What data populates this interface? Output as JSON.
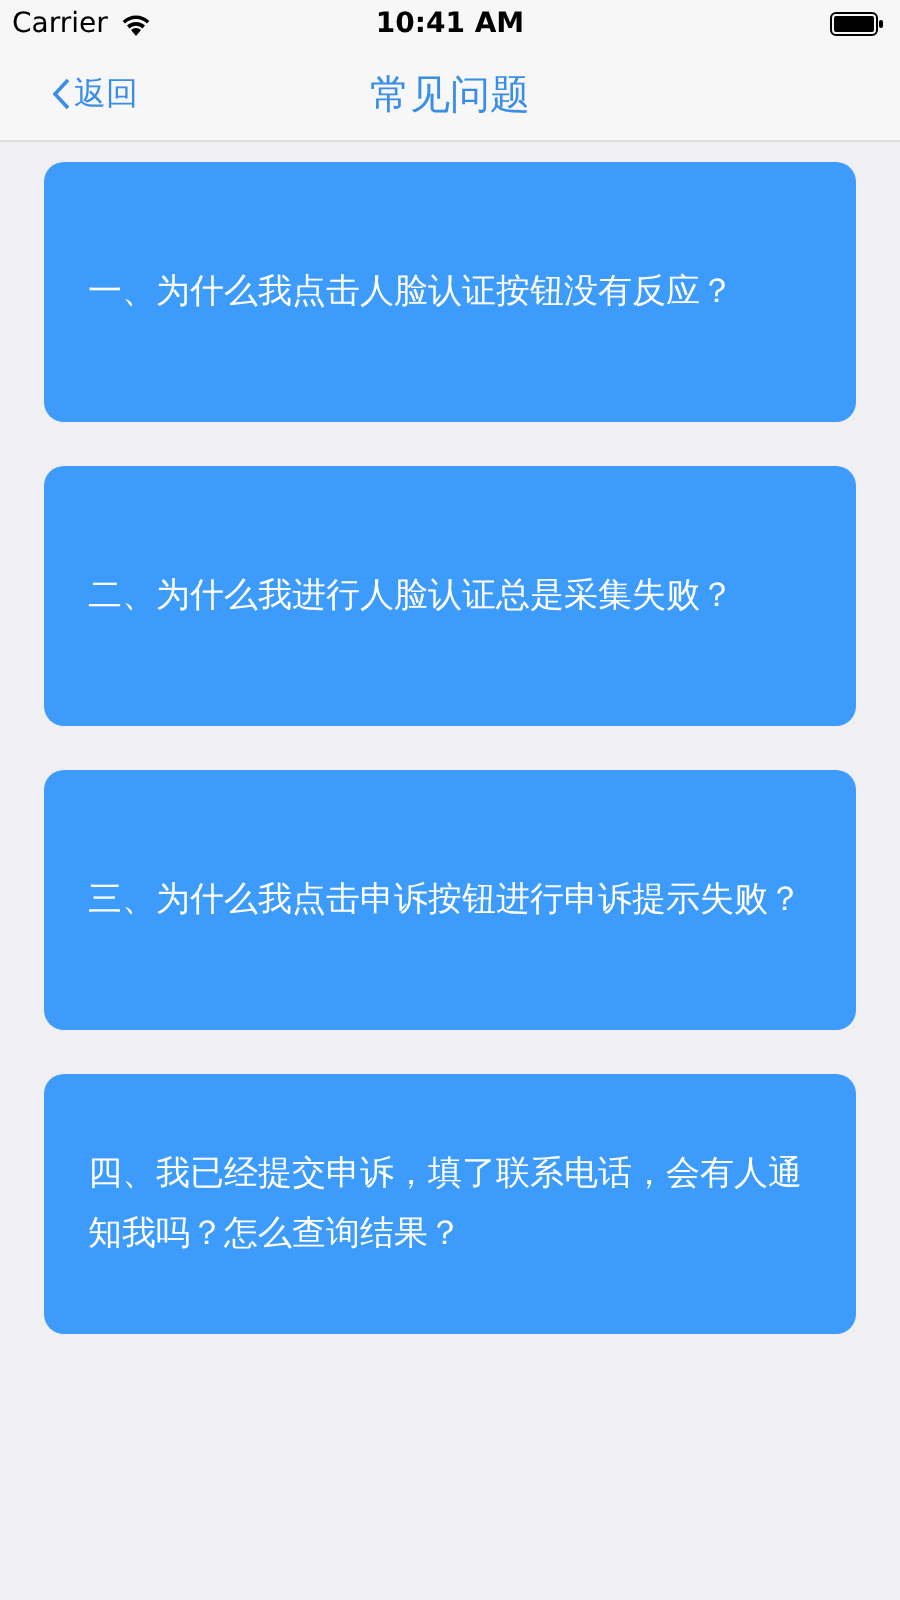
{
  "status_bar": {
    "carrier": "Carrier",
    "time": "10:41 AM"
  },
  "nav": {
    "back": "返回",
    "title": "常见问题"
  },
  "questions": [
    {
      "text": "一、为什么我点击人脸认证按钮没有反应？"
    },
    {
      "text": "二、为什么我进行人脸认证总是采集失败？"
    },
    {
      "text": "三、为什么我点击申诉按钮进行申诉提示失败？"
    },
    {
      "text": "四、我已经提交申诉，填了联系电话，会有人通知我吗？怎么查询结果？"
    }
  ]
}
